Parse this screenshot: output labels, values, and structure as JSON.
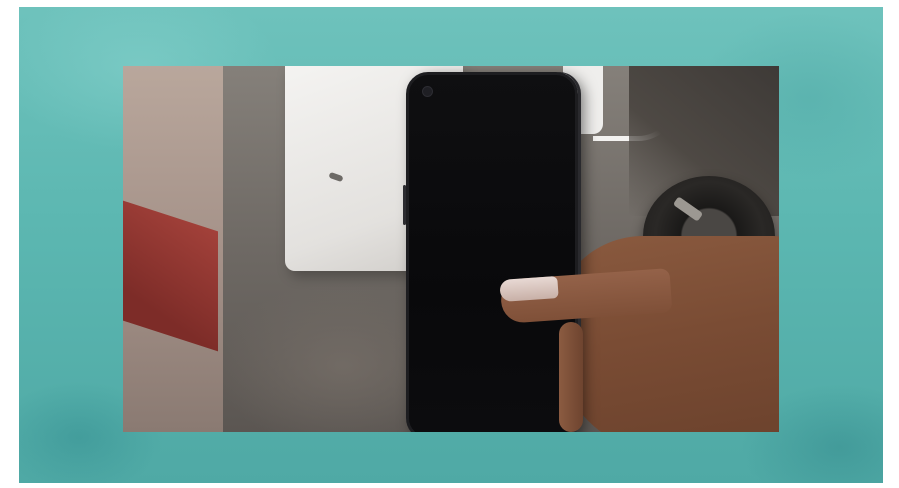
{
  "scene": {
    "frame_color": "#5cb7b1",
    "background_color": "#ffffff",
    "subject": "phone-in-hand",
    "phone_screen_color": "#09090b"
  }
}
